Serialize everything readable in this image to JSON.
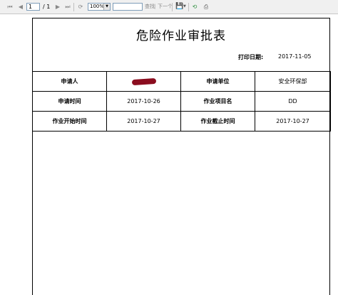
{
  "toolbar": {
    "page_current": "1",
    "page_total": "/ 1",
    "zoom": "100%",
    "find_label": "查找",
    "next_label": "下一个",
    "colors": {
      "background": "#f0f0f0",
      "input_border": "#7f9db9"
    }
  },
  "report": {
    "title": "危险作业审批表",
    "print_date_label": "打印日期:",
    "print_date": "2017-11-05",
    "rows": [
      {
        "label1": "申请人",
        "value1": "",
        "label2": "申请单位",
        "value2": "安全环保部"
      },
      {
        "label1": "申请时间",
        "value1": "2017-10-26",
        "label2": "作业项目名",
        "value2": "DD"
      },
      {
        "label1": "作业开始时间",
        "value1": "2017-10-27",
        "label2": "作业截止时间",
        "value2": "2017-10-27"
      }
    ],
    "redaction_color": "#8b0d1f"
  }
}
